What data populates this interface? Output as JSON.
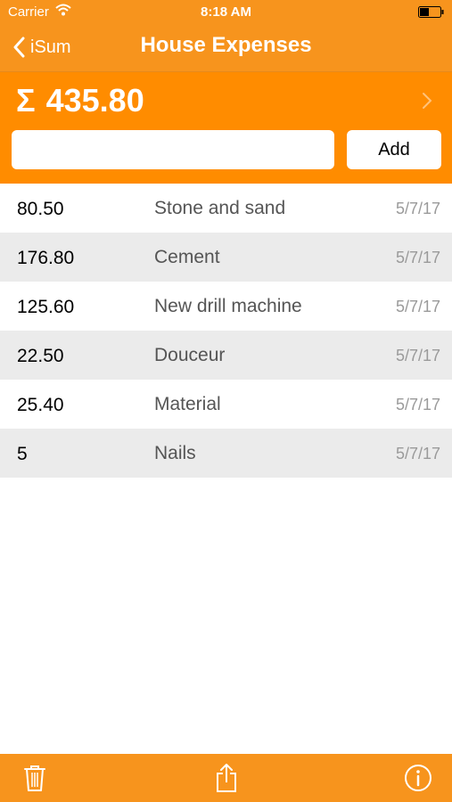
{
  "status_bar": {
    "carrier": "Carrier",
    "time": "8:18 AM",
    "wifi_icon": "wifi-icon",
    "battery_icon": "battery-icon"
  },
  "nav": {
    "back_label": "iSum",
    "title": "House Expenses"
  },
  "summary": {
    "symbol": "Σ",
    "total": "435.80"
  },
  "input": {
    "value": "",
    "placeholder": ""
  },
  "add_button_label": "Add",
  "entries": [
    {
      "amount": "80.50",
      "description": "Stone and sand",
      "date": "5/7/17"
    },
    {
      "amount": "176.80",
      "description": "Cement",
      "date": "5/7/17"
    },
    {
      "amount": "125.60",
      "description": "New drill machine",
      "date": "5/7/17"
    },
    {
      "amount": "22.50",
      "description": "Douceur",
      "date": "5/7/17"
    },
    {
      "amount": "25.40",
      "description": "Material",
      "date": "5/7/17"
    },
    {
      "amount": "5",
      "description": "Nails",
      "date": "5/7/17"
    }
  ],
  "toolbar": {
    "icons": [
      "trash-icon",
      "share-icon",
      "info-icon"
    ]
  },
  "colors": {
    "bar_orange": "#f7941d",
    "panel_orange": "#ff8c00",
    "row_alt": "#ebebeb"
  }
}
